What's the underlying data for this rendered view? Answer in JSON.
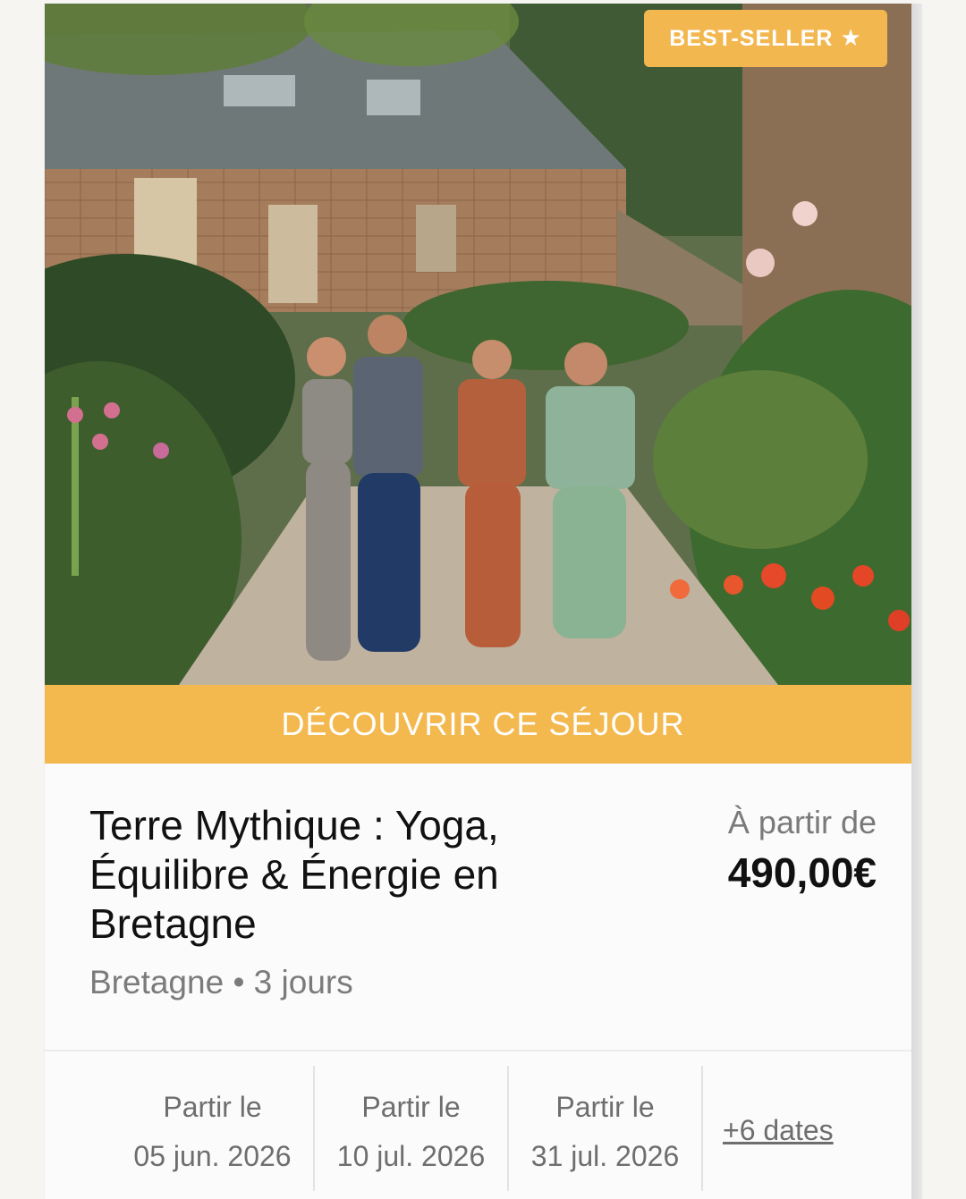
{
  "badge": {
    "label": "BEST-SELLER",
    "icon": "star-icon"
  },
  "cta": {
    "label": "DÉCOUVRIR CE SÉJOUR"
  },
  "trip": {
    "title": "Terre Mythique : Yoga, Équilibre & Énergie en Bretagne",
    "meta": "Bretagne • 3 jours",
    "price_label": "À partir de",
    "price": "490,00€"
  },
  "dates": [
    {
      "label": "Partir le",
      "date": "05 jun. 2026"
    },
    {
      "label": "Partir le",
      "date": "10 jul. 2026"
    },
    {
      "label": "Partir le",
      "date": "31 jul. 2026"
    }
  ],
  "more_dates": "+6 dates",
  "colors": {
    "accent": "#f3b94f",
    "badge": "#f3b74f"
  }
}
